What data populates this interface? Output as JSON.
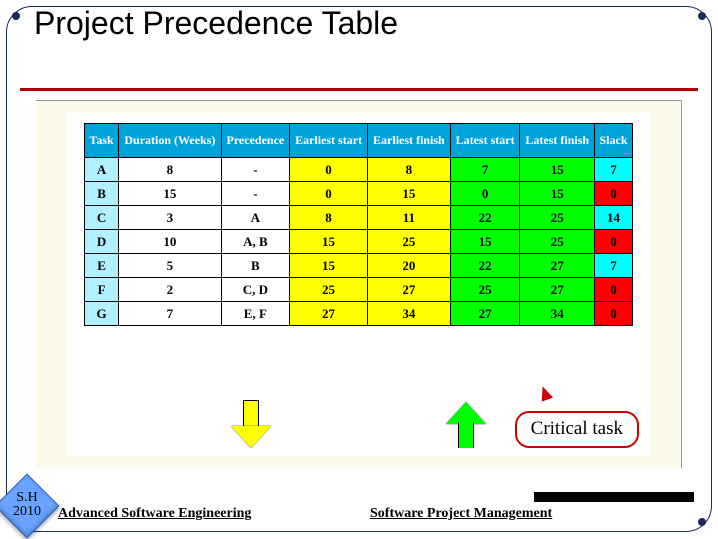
{
  "title": "Project Precedence Table",
  "headers": [
    "Task",
    "Duration (Weeks)",
    "Precedence",
    "Earliest start",
    "Earliest finish",
    "Latest start",
    "Latest finish",
    "Slack"
  ],
  "rows": [
    {
      "task": "A",
      "duration": "8",
      "precedence": "-",
      "es": "0",
      "ef": "8",
      "ls": "7",
      "lf": "15",
      "slack": "7",
      "critical": false
    },
    {
      "task": "B",
      "duration": "15",
      "precedence": "-",
      "es": "0",
      "ef": "15",
      "ls": "0",
      "lf": "15",
      "slack": "0",
      "critical": true
    },
    {
      "task": "C",
      "duration": "3",
      "precedence": "A",
      "es": "8",
      "ef": "11",
      "ls": "22",
      "lf": "25",
      "slack": "14",
      "critical": false
    },
    {
      "task": "D",
      "duration": "10",
      "precedence": "A, B",
      "es": "15",
      "ef": "25",
      "ls": "15",
      "lf": "25",
      "slack": "0",
      "critical": true
    },
    {
      "task": "E",
      "duration": "5",
      "precedence": "B",
      "es": "15",
      "ef": "20",
      "ls": "22",
      "lf": "27",
      "slack": "7",
      "critical": false
    },
    {
      "task": "F",
      "duration": "2",
      "precedence": "C, D",
      "es": "25",
      "ef": "27",
      "ls": "25",
      "lf": "27",
      "slack": "0",
      "critical": true
    },
    {
      "task": "G",
      "duration": "7",
      "precedence": "E, F",
      "es": "27",
      "ef": "34",
      "ls": "27",
      "lf": "34",
      "slack": "0",
      "critical": true
    }
  ],
  "callout": "Critical task",
  "badge": {
    "line1": "S.H",
    "line2": "2010"
  },
  "footer": {
    "left": "Advanced Software Engineering",
    "right": "Software Project Management"
  },
  "chart_data": {
    "type": "table",
    "title": "Project Precedence Table",
    "columns": [
      "Task",
      "Duration (Weeks)",
      "Precedence",
      "Earliest start",
      "Earliest finish",
      "Latest start",
      "Latest finish",
      "Slack"
    ],
    "data": [
      [
        "A",
        8,
        "-",
        0,
        8,
        7,
        15,
        7
      ],
      [
        "B",
        15,
        "-",
        0,
        15,
        0,
        15,
        0
      ],
      [
        "C",
        3,
        "A",
        8,
        11,
        22,
        25,
        14
      ],
      [
        "D",
        10,
        "A, B",
        15,
        25,
        15,
        25,
        0
      ],
      [
        "E",
        5,
        "B",
        15,
        20,
        22,
        27,
        7
      ],
      [
        "F",
        2,
        "C, D",
        25,
        27,
        25,
        27,
        0
      ],
      [
        "G",
        7,
        "E, F",
        27,
        34,
        27,
        34,
        0
      ]
    ],
    "annotations": [
      "Critical task = slack 0 (red)"
    ]
  }
}
